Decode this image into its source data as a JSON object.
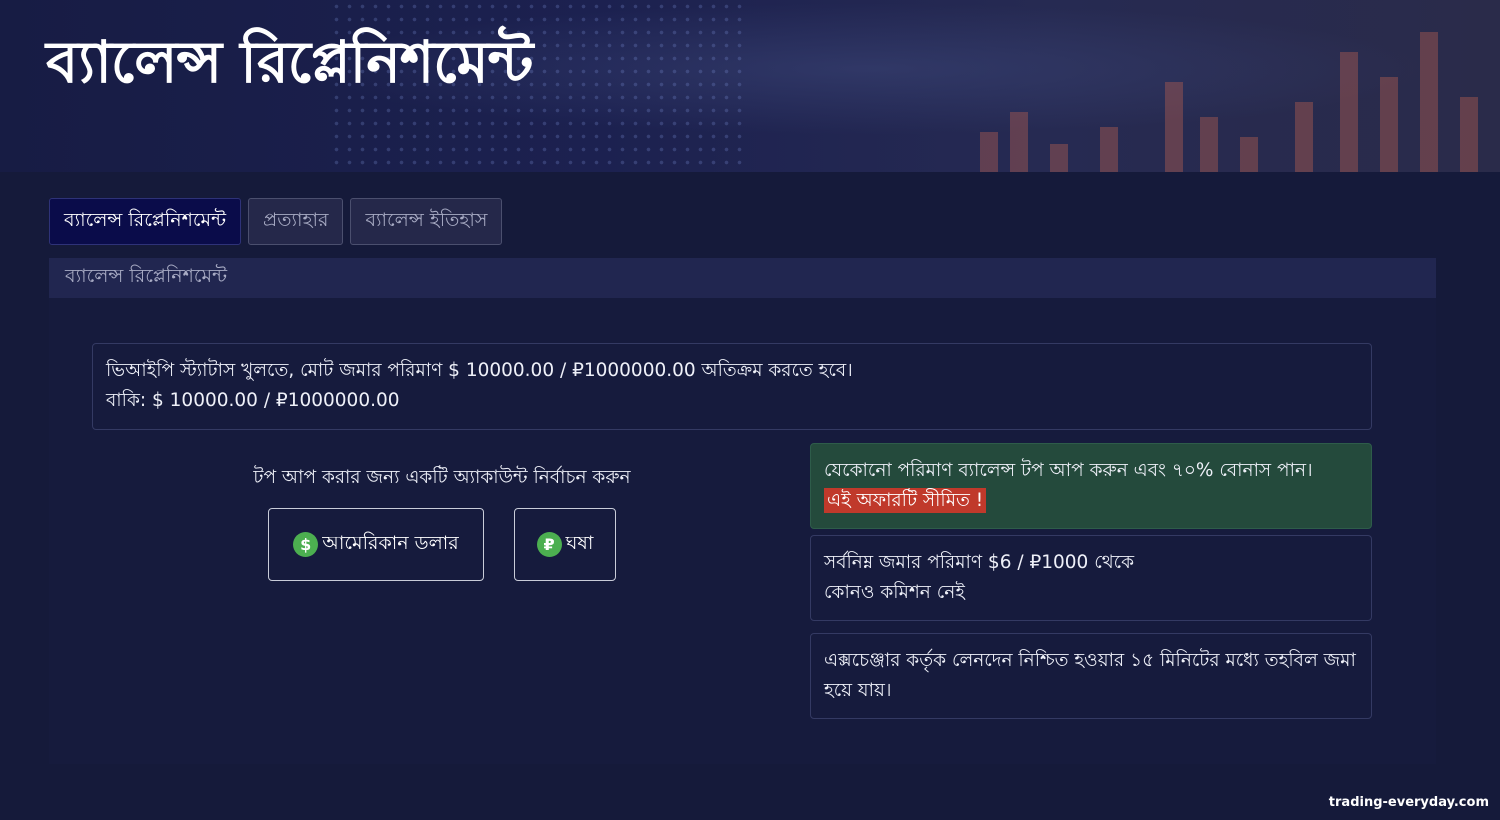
{
  "hero": {
    "title": "ব্যালেন্স রিপ্লেনিশমেন্ট"
  },
  "tabs": [
    {
      "label": "ব্যালেন্স রিপ্লেনিশমেন্ট",
      "active": true
    },
    {
      "label": "প্রত্যাহার",
      "active": false
    },
    {
      "label": "ব্যালেন্স ইতিহাস",
      "active": false
    }
  ],
  "section": {
    "title": "ব্যালেন্স রিপ্লেনিশমেন্ট"
  },
  "vip": {
    "line1": "ভিআইপি স্ট্যাটাস খুলতে, মোট জমার পরিমাণ $ 10000.00 / ₽1000000.00 অতিক্রম করতে হবে।",
    "line2": "বাকি: $ 10000.00 / ₽1000000.00"
  },
  "account_select": {
    "label": "টপ আপ করার জন্য একটি অ্যাকাউন্ট নির্বাচন করুন",
    "usd_label": "আমেরিকান ডলার",
    "usd_symbol": "$",
    "rub_label": "ঘষা",
    "rub_symbol": "₽"
  },
  "bonus": {
    "text": "যেকোনো পরিমাণ ব্যালেন্স টপ আপ করুন এবং ৭০% বোনাস পান।",
    "limited": "এই অফারটি সীমিত !"
  },
  "info_min": {
    "line1": "সর্বনিম্ন জমার পরিমাণ $6 / ₽1000 থেকে",
    "line2": "কোনও কমিশন নেই"
  },
  "info_time": {
    "text": "এক্সচেঞ্জার কর্তৃক লেনদেন নিশ্চিত হওয়ার ১৫ মিনিটের মধ্যে তহবিল জমা হয়ে যায়।"
  },
  "watermark": "trading-everyday.com",
  "colors": {
    "background": "#151a3a",
    "active_tab": "#0a0c4a",
    "bonus_card": "#244a3c",
    "limited_badge": "#c0392b",
    "currency_icon": "#4caf50"
  }
}
